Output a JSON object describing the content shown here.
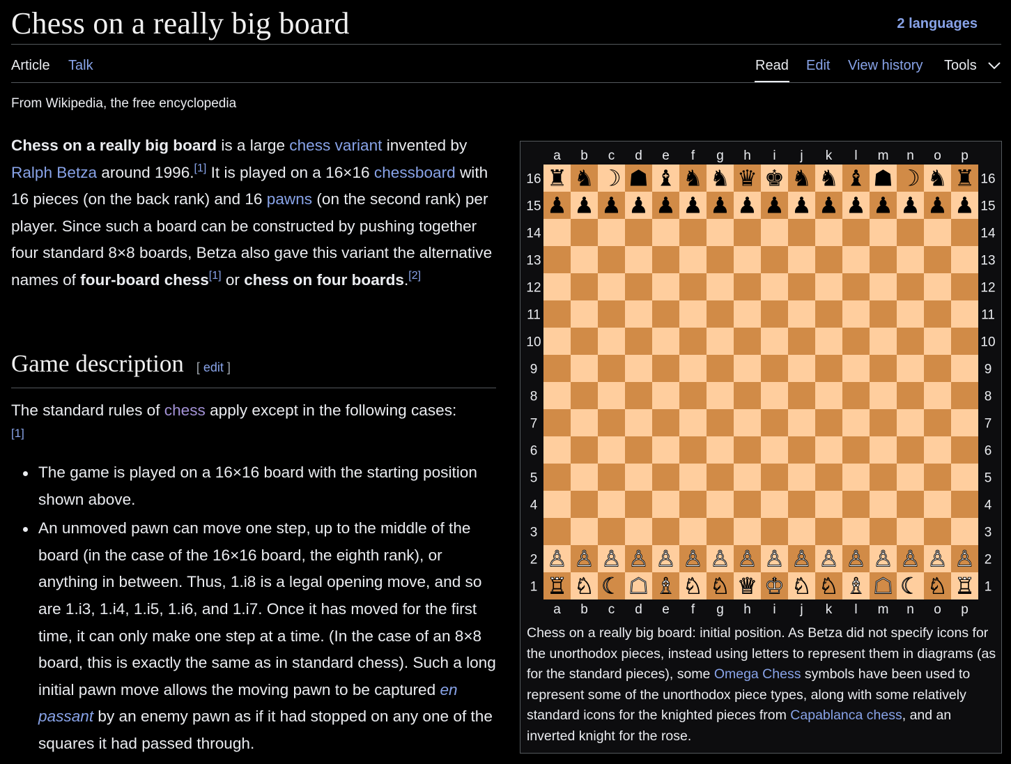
{
  "page": {
    "title": "Chess on a really big board",
    "languages": "2 languages",
    "tabs_left": [
      "Article",
      "Talk"
    ],
    "tabs_right": [
      "Read",
      "Edit",
      "View history",
      "Tools"
    ],
    "tagline": "From Wikipedia, the free encyclopedia"
  },
  "intro": {
    "b1": "Chess on a really big board",
    "t1": " is a large ",
    "l1": "chess variant",
    "t2": " invented by ",
    "l2": "Ralph Betza",
    "t3": " around 1996.",
    "ref1": "[1]",
    "t4": " It is played on a 16×16 ",
    "l3": "chessboard",
    "t5": " with 16 pieces (on the back rank) and 16 ",
    "l4": "pawns",
    "t6": " (on the second rank) per player. Since such a board can be constructed by pushing together four standard 8×8 boards, Betza also gave this variant the alternative names of ",
    "b2": "four-board chess",
    "ref2": "[1]",
    "t7": " or ",
    "b3": "chess on four boards",
    "t8": ".",
    "ref3": "[2]"
  },
  "section": {
    "heading": "Game description",
    "edit_label": "edit",
    "rules_t1": "The standard rules of ",
    "rules_link": "chess",
    "rules_t2": " apply except in the following cases:",
    "rules_ref": "[1]",
    "bullet1": "The game is played on a 16×16 board with the starting position shown above.",
    "bullet2_t1": "An unmoved pawn can move one step, up to the middle of the board (in the case of the 16×16 board, the eighth rank), or anything in between. Thus, 1.i8 is a legal opening move, and so are 1.i3, 1.i4, 1.i5, 1.i6, and 1.i7. Once it has moved for the first time, it can only make one step at a time. (In the case of an 8×8 board, this is exactly the same as in standard chess). Such a long initial pawn move allows the moving pawn to be captured ",
    "bullet2_link": "en passant",
    "bullet2_t2": " by an enemy pawn as if it had stopped on any one of the squares it had passed through."
  },
  "board": {
    "files": [
      "a",
      "b",
      "c",
      "d",
      "e",
      "f",
      "g",
      "h",
      "i",
      "j",
      "k",
      "l",
      "m",
      "n",
      "o",
      "p"
    ],
    "ranks": [
      "16",
      "15",
      "14",
      "13",
      "12",
      "11",
      "10",
      "9",
      "8",
      "7",
      "6",
      "5",
      "4",
      "3",
      "2",
      "1"
    ],
    "light_color": "#ffce9e",
    "dark_color": "#d18b47",
    "black_back_rank": [
      "♜",
      "♞",
      "☽",
      "☗",
      "♝",
      "♞",
      "♞",
      "♛",
      "♚",
      "♞",
      "♞",
      "♝",
      "☗",
      "☽",
      "♞",
      "♜"
    ],
    "black_pawns": [
      "♟",
      "♟",
      "♟",
      "♟",
      "♟",
      "♟",
      "♟",
      "♟",
      "♟",
      "♟",
      "♟",
      "♟",
      "♟",
      "♟",
      "♟",
      "♟"
    ],
    "white_pawns": [
      "♙",
      "♙",
      "♙",
      "♙",
      "♙",
      "♙",
      "♙",
      "♙",
      "♙",
      "♙",
      "♙",
      "♙",
      "♙",
      "♙",
      "♙",
      "♙"
    ],
    "white_back_rank": [
      "♖",
      "♘",
      "☾",
      "☖",
      "♗",
      "♘",
      "♘",
      "♕",
      "♔",
      "♘",
      "♘",
      "♗",
      "☖",
      "☾",
      "♘",
      "♖"
    ]
  },
  "caption": {
    "t1": "Chess on a really big board: initial position. As Betza did not specify icons for the unorthodox pieces, instead using letters to represent them in diagrams (as for the standard pieces), some ",
    "l1": "Omega Chess",
    "t2": " symbols have been used to represent some of the unorthodox piece types, along with some relatively standard icons for the knighted pieces from ",
    "l2": "Capablanca chess",
    "t3": ", and an inverted knight for the rose."
  }
}
